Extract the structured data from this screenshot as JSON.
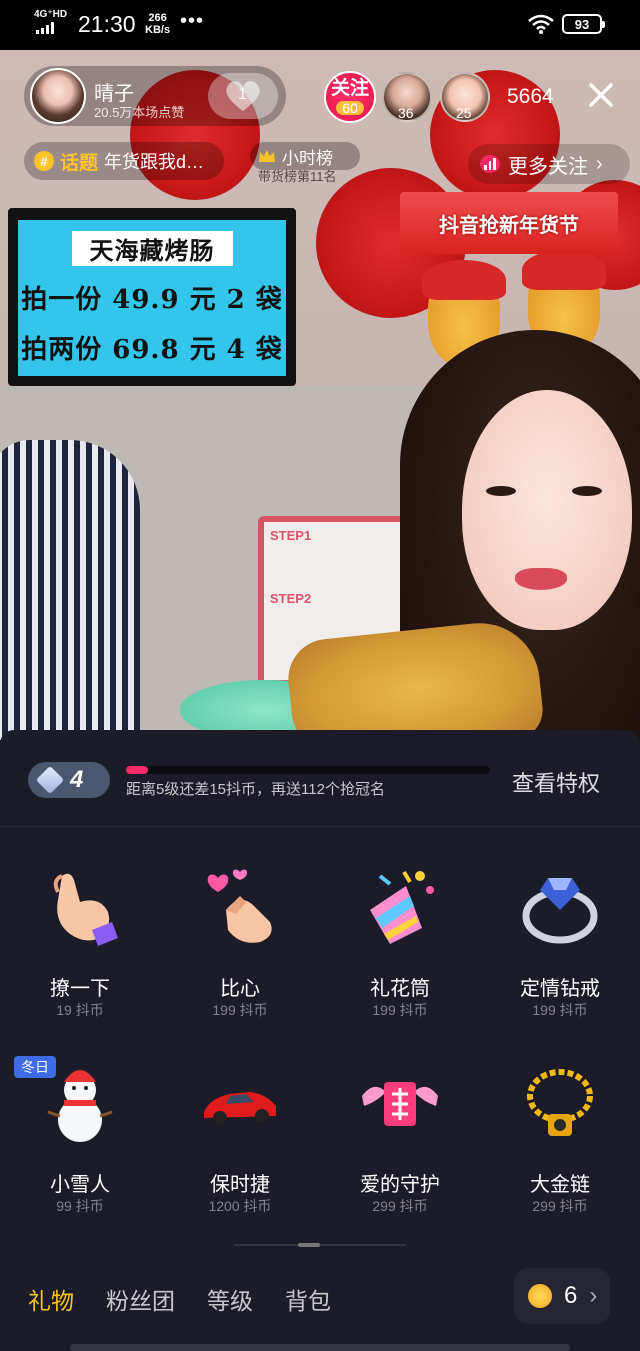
{
  "status_bar": {
    "network": "4G⁺HD",
    "time": "21:30",
    "speed_value": "266",
    "speed_unit": "KB/s",
    "more": "•••",
    "battery": "93",
    "icons": [
      "signal-icon",
      "wifi-icon",
      "battery-icon"
    ]
  },
  "live": {
    "host": {
      "name": "晴子",
      "likes": "20.5万本场点赞"
    },
    "like_count": "1",
    "follow": {
      "label": "关注",
      "level": "60"
    },
    "viewers": [
      {
        "num": "36"
      },
      {
        "num": "25"
      }
    ],
    "viewer_count": "5664",
    "topic": {
      "label": "话题",
      "text": "年货跟我d…"
    },
    "rank": {
      "label": "小时榜",
      "sub": "带货榜第11名"
    },
    "more_follow": "更多关注",
    "banner": "抖音抢新年货节",
    "tv": {
      "title": "天海藏烤肠",
      "line1": "拍一份 49.9 元 2 袋",
      "line2": "拍两份 69.8 元 4 袋"
    },
    "board": {
      "step1": "STEP1",
      "step2": "STEP2"
    }
  },
  "gift_panel": {
    "level": "4",
    "progress": 0.06,
    "progress_text": "距离5级还差15抖币，再送112个抢冠名",
    "privilege_link": "查看特权",
    "season_tag": "冬日",
    "gifts": [
      {
        "name": "撩一下",
        "price": "19 抖币",
        "icon": "hand-beckon-icon"
      },
      {
        "name": "比心",
        "price": "199 抖币",
        "icon": "finger-heart-icon"
      },
      {
        "name": "礼花筒",
        "price": "199 抖币",
        "icon": "party-popper-icon"
      },
      {
        "name": "定情钻戒",
        "price": "199 抖币",
        "icon": "diamond-ring-icon"
      },
      {
        "name": "小雪人",
        "price": "99 抖币",
        "icon": "snowman-icon"
      },
      {
        "name": "保时捷",
        "price": "1200 抖币",
        "icon": "sports-car-icon"
      },
      {
        "name": "爱的守护",
        "price": "299 抖币",
        "icon": "winged-love-icon"
      },
      {
        "name": "大金链",
        "price": "299 抖币",
        "icon": "gold-chain-icon"
      }
    ],
    "tabs": [
      {
        "label": "礼物",
        "active": true
      },
      {
        "label": "粉丝团",
        "active": false
      },
      {
        "label": "等级",
        "active": false
      },
      {
        "label": "背包",
        "active": false
      }
    ],
    "coins": "6",
    "colors": {
      "accent": "#f7c32b",
      "progress": "#ff2a6a",
      "panel": "#1c1c28"
    }
  }
}
